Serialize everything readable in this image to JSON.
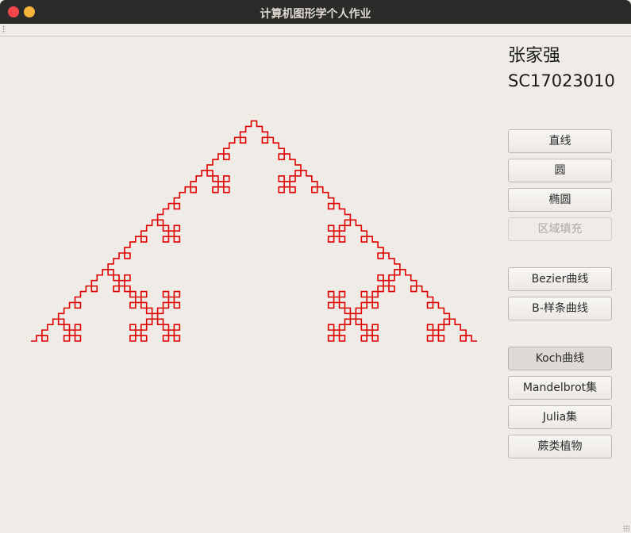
{
  "window": {
    "title": "计算机图形学个人作业"
  },
  "author": {
    "name": "张家强",
    "student_id": "SC17023010"
  },
  "buttons": [
    {
      "label": "直线",
      "state": "normal"
    },
    {
      "label": "圆",
      "state": "normal"
    },
    {
      "label": "椭圆",
      "state": "normal"
    },
    {
      "label": "区域填充",
      "state": "disabled"
    },
    {
      "label": "Bezier曲线",
      "state": "normal"
    },
    {
      "label": "B-样条曲线",
      "state": "normal"
    },
    {
      "label": "Koch曲线",
      "state": "active"
    },
    {
      "label": "Mandelbrot集",
      "state": "normal"
    },
    {
      "label": "Julia集",
      "state": "normal"
    },
    {
      "label": "蕨类植物",
      "state": "normal"
    }
  ],
  "drawing": {
    "type": "koch-curve",
    "color": "#e00000",
    "iterations": 4
  }
}
